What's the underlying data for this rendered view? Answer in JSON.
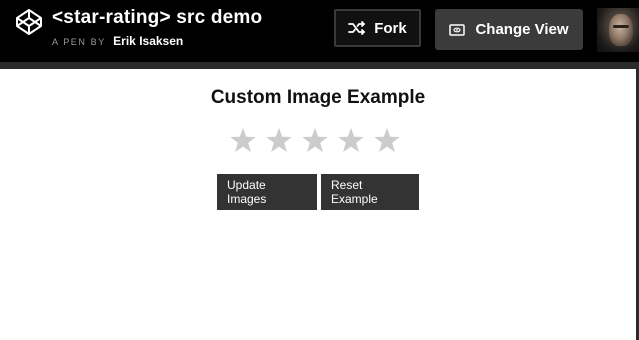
{
  "header": {
    "title": "<star-rating> src demo",
    "byline_prefix": "A PEN BY",
    "author": "Erik Isaksen",
    "fork_label": "Fork",
    "change_view_label": "Change View",
    "icons": {
      "logo": "codepen-logo-icon",
      "fork": "fork-icon",
      "change_view": "change-view-icon"
    }
  },
  "preview": {
    "heading": "Custom Image Example",
    "rating": {
      "value": 0,
      "max": 5,
      "star_color": "#cccccc"
    },
    "buttons": {
      "update": "Update Images",
      "reset": "Reset Example"
    }
  },
  "colors": {
    "header_bg": "#000000",
    "button_bg": "#333333",
    "change_view_bg": "#3b3b3b"
  }
}
